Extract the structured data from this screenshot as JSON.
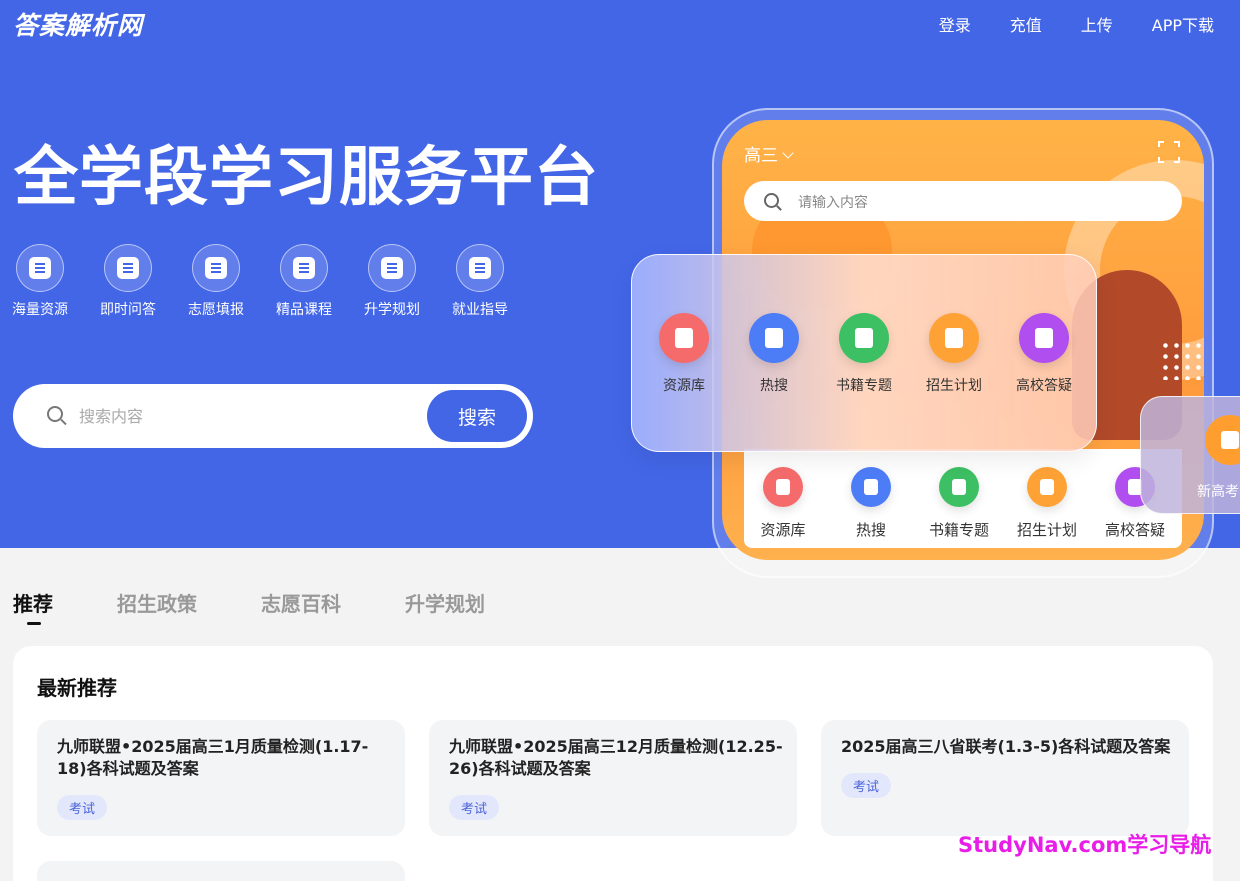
{
  "header": {
    "logo": "答案解析网",
    "nav": [
      "登录",
      "充值",
      "上传",
      "APP下载"
    ]
  },
  "hero": {
    "slogan": "全学段学习服务平台",
    "features": [
      "海量资源",
      "即时问答",
      "志愿填报",
      "精品课程",
      "升学规划",
      "就业指导"
    ],
    "search": {
      "placeholder": "搜索内容",
      "button": "搜索"
    }
  },
  "phone": {
    "grade": "高三",
    "search_placeholder": "请输入内容",
    "quick_items": [
      {
        "label": "资源库",
        "color": "#f56b6b",
        "icon": "drawer-icon"
      },
      {
        "label": "热搜",
        "color": "#4d7cf7",
        "icon": "flame-icon"
      },
      {
        "label": "书籍专题",
        "color": "#3dbf63",
        "icon": "book-icon"
      },
      {
        "label": "招生计划",
        "color": "#ffa236",
        "icon": "checklist-icon"
      },
      {
        "label": "高校答疑",
        "color": "#b04ef0",
        "icon": "chat-icon"
      }
    ],
    "side_card_label": "新高考",
    "side_card_color": "#ff9d2e"
  },
  "tabs": [
    "推荐",
    "招生政策",
    "志愿百科",
    "升学规划"
  ],
  "recommend": {
    "title": "最新推荐",
    "cards": [
      {
        "title": "九师联盟•2025届高三1月质量检测(1.17-18)各科试题及答案",
        "tag": "考试"
      },
      {
        "title": "九师联盟•2025届高三12月质量检测(12.25-26)各科试题及答案",
        "tag": "考试"
      },
      {
        "title": "2025届高三八省联考(1.3-5)各科试题及答案",
        "tag": "考试"
      }
    ]
  },
  "watermark": "StudyNav.com学习导航",
  "colors": {
    "brand": "#4366e7",
    "watermark": "#e81ee8"
  }
}
